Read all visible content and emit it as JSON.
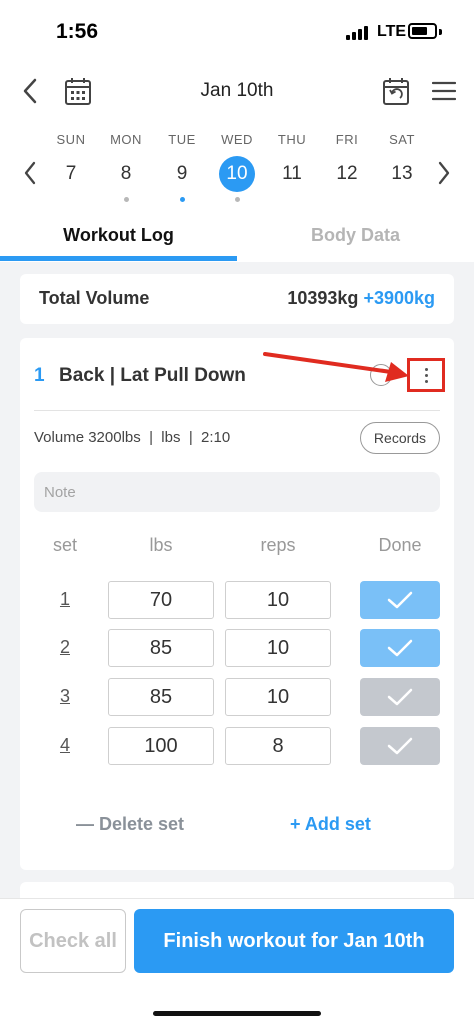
{
  "status": {
    "time": "1:56",
    "network": "LTE"
  },
  "header": {
    "date_title": "Jan 10th"
  },
  "week": {
    "days": [
      {
        "name": "SUN",
        "num": "7",
        "dot": "none"
      },
      {
        "name": "MON",
        "num": "8",
        "dot": "gray"
      },
      {
        "name": "TUE",
        "num": "9",
        "dot": "blue"
      },
      {
        "name": "WED",
        "num": "10",
        "dot": "gray",
        "selected": true
      },
      {
        "name": "THU",
        "num": "11",
        "dot": "none"
      },
      {
        "name": "FRI",
        "num": "12",
        "dot": "none"
      },
      {
        "name": "SAT",
        "num": "13",
        "dot": "none"
      }
    ]
  },
  "tabs": {
    "workout_log": "Workout Log",
    "body_data": "Body Data"
  },
  "summary": {
    "label": "Total Volume",
    "value": "10393kg",
    "delta": "+3900kg"
  },
  "exercise": {
    "index": "1",
    "title": "Back | Lat Pull Down",
    "meta": "Volume 3200lbs  |  lbs  |  2:10",
    "records_label": "Records",
    "note_placeholder": "Note",
    "columns": {
      "set": "set",
      "lbs": "lbs",
      "reps": "reps",
      "done": "Done"
    },
    "sets": [
      {
        "num": "1",
        "lbs": "70",
        "reps": "10",
        "done": true
      },
      {
        "num": "2",
        "lbs": "85",
        "reps": "10",
        "done": true
      },
      {
        "num": "3",
        "lbs": "85",
        "reps": "10",
        "done": false
      },
      {
        "num": "4",
        "lbs": "100",
        "reps": "8",
        "done": false
      }
    ],
    "delete_set": "— Delete set",
    "add_set": "+ Add set"
  },
  "footer": {
    "check_all": "Check all",
    "finish": "Finish workout for Jan 10th"
  },
  "colors": {
    "accent": "#2b9af3",
    "done_on": "#7ac0f7",
    "done_off": "#c4c8ce",
    "highlight": "#e02b20"
  }
}
